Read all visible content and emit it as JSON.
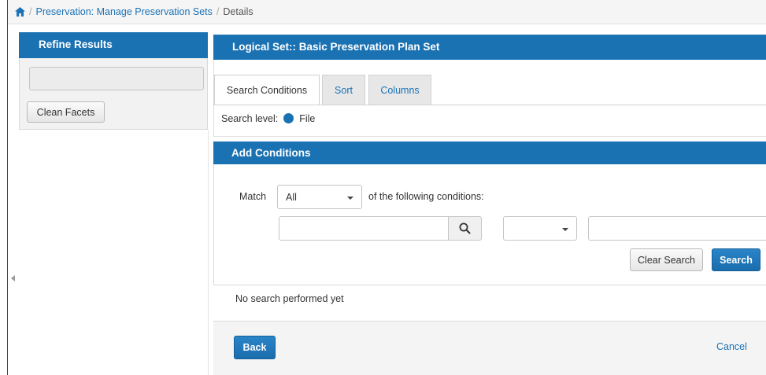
{
  "breadcrumb": {
    "home_icon": "home-icon",
    "items": [
      "Preservation: Manage Preservation Sets",
      "Details"
    ],
    "separator": "/"
  },
  "sidebar": {
    "title": "Refine Results",
    "search_value": "",
    "clean_facets_label": "Clean Facets",
    "collapse_icon": "caret-left-icon"
  },
  "main": {
    "title": "Logical Set:: Basic Preservation Plan Set",
    "tabs": [
      {
        "label": "Search Conditions",
        "active": true
      },
      {
        "label": "Sort",
        "active": false
      },
      {
        "label": "Columns",
        "active": false
      }
    ],
    "search_level": {
      "label": "Search level:",
      "value": "File"
    }
  },
  "conditions": {
    "title": "Add Conditions",
    "match_label": "Match",
    "match_value": "All",
    "following_text": "of the following conditions:",
    "field_value": "",
    "operator_value": "",
    "value_input": "",
    "clear_label": "Clear Search",
    "search_label": "Search"
  },
  "status": {
    "text": "No search performed yet"
  },
  "footer": {
    "back_label": "Back",
    "cancel_label": "Cancel"
  },
  "colors": {
    "accent": "#1a72b3",
    "link": "#1b72b5",
    "panel_bg": "#f2f2f2"
  }
}
